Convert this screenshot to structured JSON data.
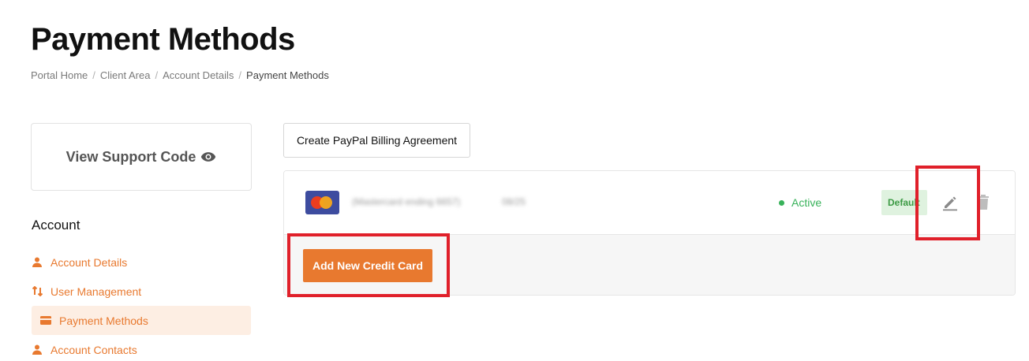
{
  "page": {
    "title": "Payment Methods"
  },
  "breadcrumb": {
    "items": [
      "Portal Home",
      "Client Area",
      "Account Details"
    ],
    "separator": "/",
    "current": "Payment Methods"
  },
  "support": {
    "label": "View Support Code",
    "icon": "eye-icon"
  },
  "sidebar": {
    "heading": "Account",
    "items": [
      {
        "label": "Account Details",
        "icon": "user-icon"
      },
      {
        "label": "User Management",
        "icon": "sort-arrows-icon"
      },
      {
        "label": "Payment Methods",
        "icon": "credit-card-icon",
        "active": true
      },
      {
        "label": "Account Contacts",
        "icon": "user-icon"
      }
    ]
  },
  "actions": {
    "paypal_label": "Create PayPal Billing Agreement"
  },
  "card": {
    "brand_icon": "mastercard-icon",
    "description": "(Mastercard ending 6657)",
    "expiry": "08/25",
    "status": "Active",
    "default_badge": "Default"
  },
  "footer": {
    "add_card_label": "Add New Credit Card"
  },
  "colors": {
    "accent": "#e8792f",
    "active_green": "#38b25a",
    "highlight": "#e0202a"
  }
}
